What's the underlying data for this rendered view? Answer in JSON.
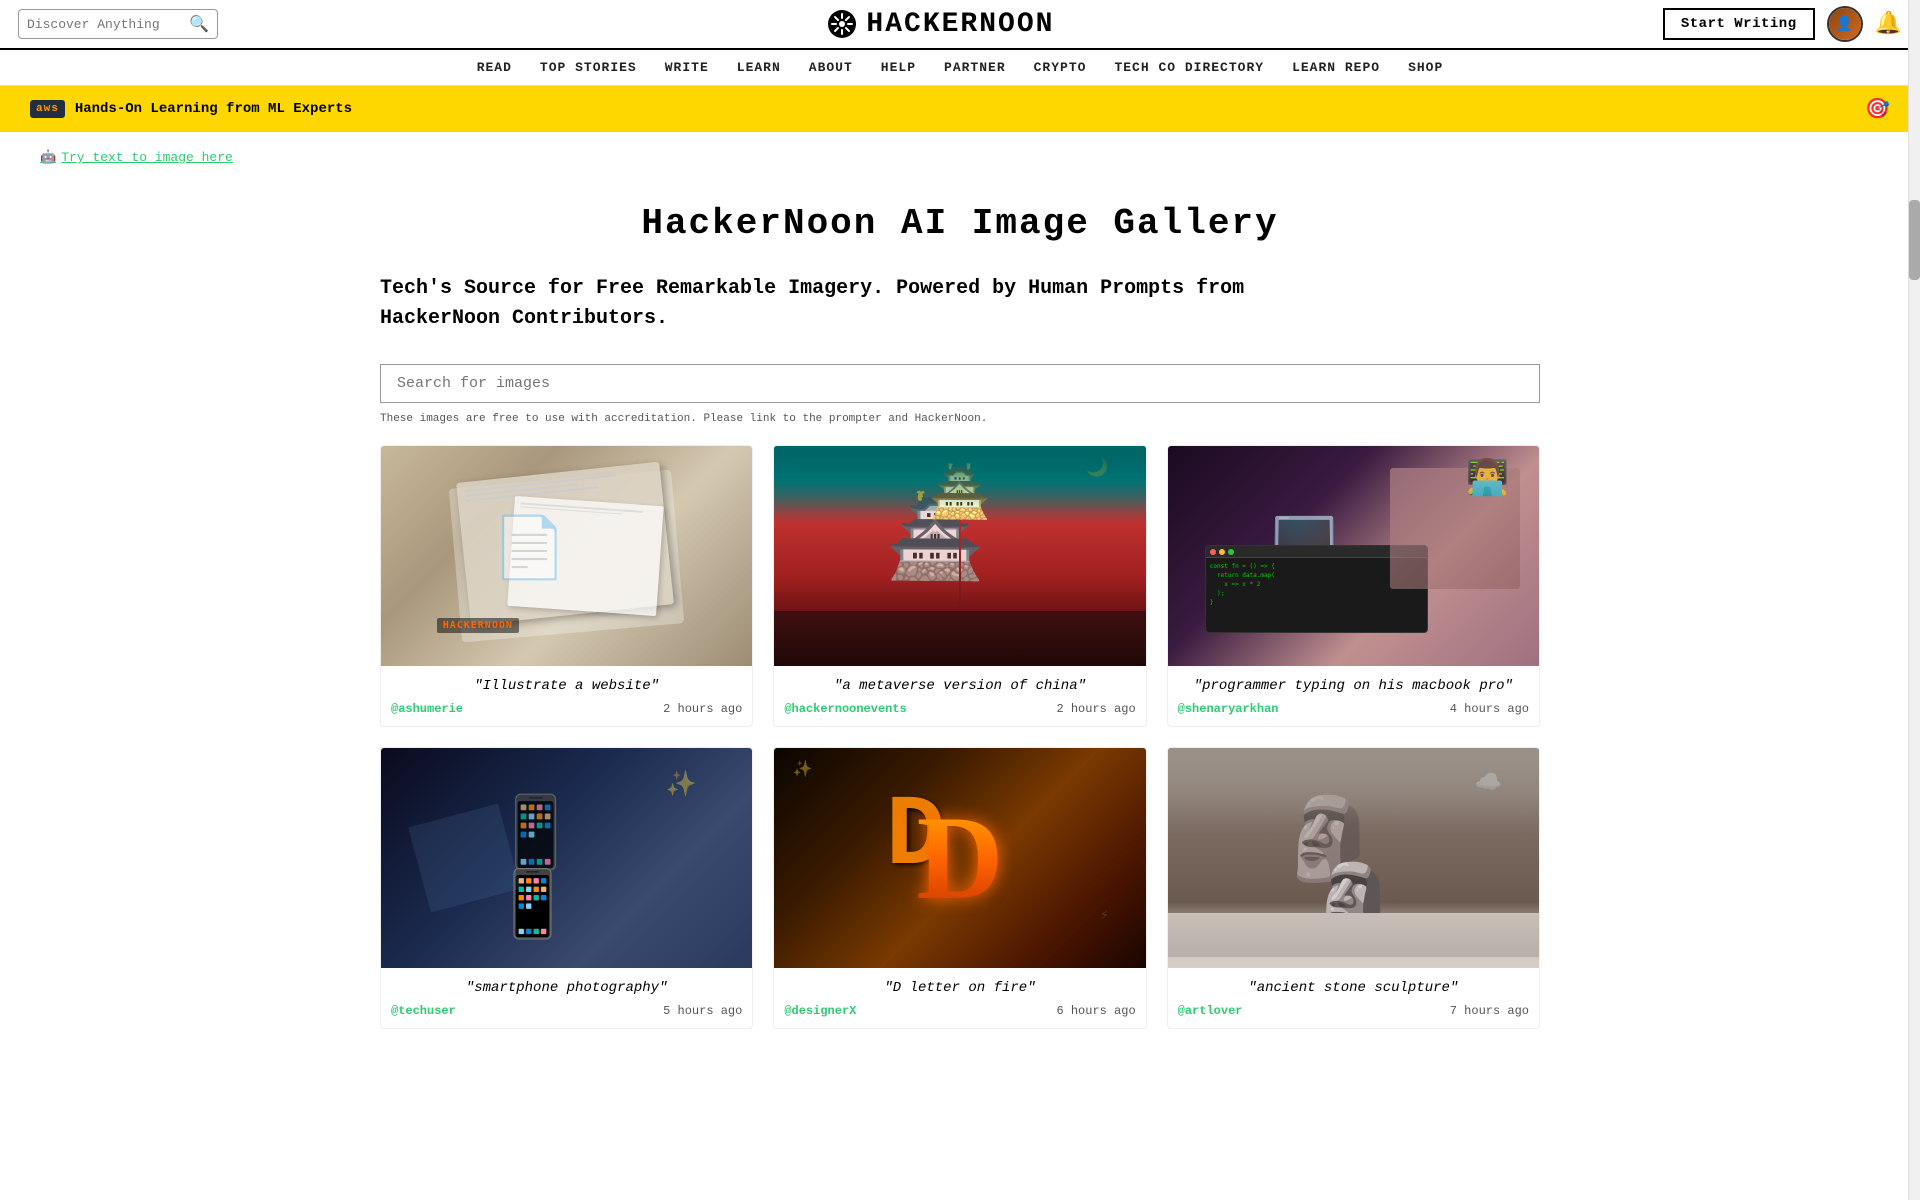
{
  "topbar": {
    "search_placeholder": "Discover Anything",
    "logo_text": "HACKERNOON",
    "start_writing_label": "Start Writing"
  },
  "nav": {
    "items": [
      {
        "label": "READ",
        "href": "#"
      },
      {
        "label": "TOP STORIES",
        "href": "#"
      },
      {
        "label": "WRITE",
        "href": "#"
      },
      {
        "label": "LEARN",
        "href": "#"
      },
      {
        "label": "ABOUT",
        "href": "#"
      },
      {
        "label": "HELP",
        "href": "#"
      },
      {
        "label": "PARTNER",
        "href": "#"
      },
      {
        "label": "CRYPTO",
        "href": "#"
      },
      {
        "label": "TECH CO DIRECTORY",
        "href": "#"
      },
      {
        "label": "LEARN REPO",
        "href": "#"
      },
      {
        "label": "SHOP",
        "href": "#"
      }
    ]
  },
  "banner": {
    "badge": "aws",
    "text": "Hands-On Learning from ML Experts",
    "icon": "🎯"
  },
  "try_link": {
    "label": "Try text to image here",
    "emoji": "🤖"
  },
  "page": {
    "title": "HackerNoon AI Image Gallery",
    "subtitle": "Tech's Source for Free Remarkable Imagery. Powered by Human Prompts from HackerNoon Contributors.",
    "search_placeholder": "Search for images",
    "disclaimer": "These images are free to use with accreditation. Please link to the prompter and HackerNoon."
  },
  "images": [
    {
      "caption": "\"Illustrate a website\"",
      "author": "@ashumerie",
      "time": "2 hours ago",
      "img_class": "img-1"
    },
    {
      "caption": "\"a metaverse version of china\"",
      "author": "@hackernoonevents",
      "time": "2 hours ago",
      "img_class": "img-2"
    },
    {
      "caption": "\"programmer typing on his macbook pro\"",
      "author": "@shenaryarkhan",
      "time": "4 hours ago",
      "img_class": "img-3"
    },
    {
      "caption": "\"smartphone photography\"",
      "author": "@techuser",
      "time": "5 hours ago",
      "img_class": "img-4"
    },
    {
      "caption": "\"D letter on fire\"",
      "author": "@designerX",
      "time": "6 hours ago",
      "img_class": "img-5"
    },
    {
      "caption": "\"ancient stone sculpture\"",
      "author": "@artlover",
      "time": "7 hours ago",
      "img_class": "img-6"
    }
  ]
}
